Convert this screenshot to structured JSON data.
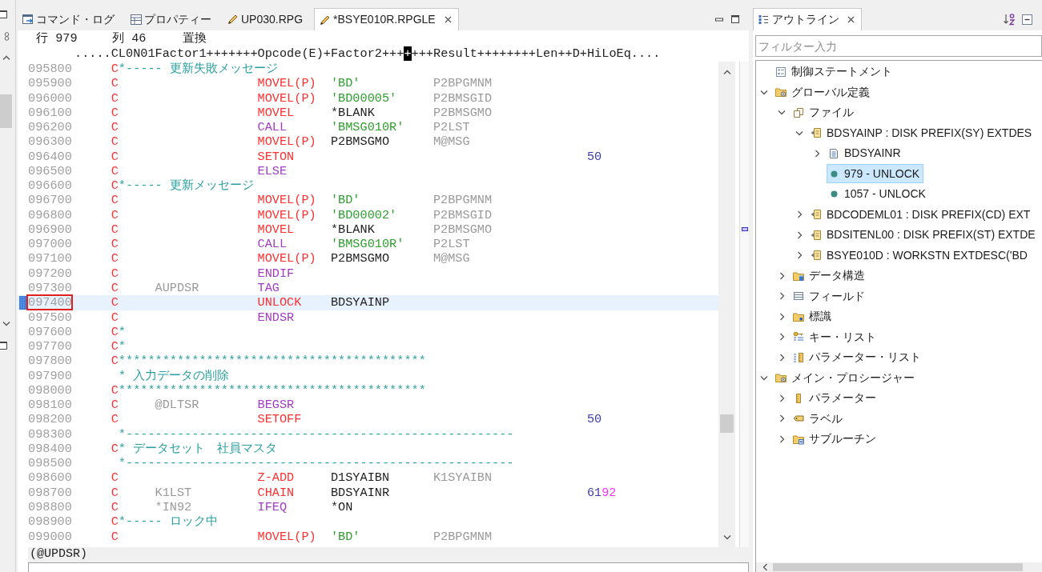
{
  "editor": {
    "tabs": [
      {
        "label": "コマンド・ログ",
        "kind": "log",
        "selected": false
      },
      {
        "label": "プロパティー",
        "kind": "properties",
        "selected": false
      },
      {
        "label": "UP030.RPG",
        "kind": "source",
        "selected": false
      },
      {
        "label": "*BSYE010R.RPGLE",
        "kind": "source",
        "selected": true
      }
    ],
    "status": {
      "line": "行 979",
      "column": "列 46",
      "mode": "置換"
    },
    "ruler": {
      "before": ".....CL0N01Factor1+++++++Opcode(E)+Factor2+++",
      "cursor": "+",
      "after": "+++Result++++++++Len++D+HiLoEq...."
    },
    "lines": [
      {
        "seq": "095800",
        "kind": "comment",
        "spec": "C",
        "comment": "*----- 更新失敗メッセージ",
        "current": false
      },
      {
        "seq": "095900",
        "kind": "code",
        "spec": "C",
        "opcode": {
          "text": "MOVEL(P)",
          "kind": "operation"
        },
        "factor2": {
          "text": "'BD'",
          "kind": "literal"
        },
        "result": "P2BPGMNM",
        "current": false
      },
      {
        "seq": "096000",
        "kind": "code",
        "spec": "C",
        "opcode": {
          "text": "MOVEL(P)",
          "kind": "operation"
        },
        "factor2": {
          "text": "'BD00005'",
          "kind": "literal"
        },
        "result": "P2BMSGID",
        "current": false
      },
      {
        "seq": "096100",
        "kind": "code",
        "spec": "C",
        "opcode": {
          "text": "MOVEL",
          "kind": "operation"
        },
        "factor2": {
          "text": "*BLANK",
          "kind": "name"
        },
        "result": "P2BMSGMO",
        "current": false
      },
      {
        "seq": "096200",
        "kind": "code",
        "spec": "C",
        "opcode": {
          "text": "CALL",
          "kind": "control"
        },
        "factor2": {
          "text": "'BMSG010R'",
          "kind": "literal"
        },
        "result": "P2LST",
        "current": false
      },
      {
        "seq": "096300",
        "kind": "code",
        "spec": "C",
        "opcode": {
          "text": "MOVEL(P)",
          "kind": "operation"
        },
        "factor2": {
          "text": "P2BMSGMO",
          "kind": "name"
        },
        "result": "M@MSG",
        "current": false
      },
      {
        "seq": "096400",
        "kind": "code",
        "spec": "C",
        "opcode": {
          "text": "SETON",
          "kind": "operation"
        },
        "indicators": [
          {
            "text": "50",
            "color": "#3c3ca8"
          }
        ],
        "current": false
      },
      {
        "seq": "096500",
        "kind": "code",
        "spec": "C",
        "opcode": {
          "text": "ELSE",
          "kind": "control"
        },
        "current": false
      },
      {
        "seq": "096600",
        "kind": "comment",
        "spec": "C",
        "comment": "*----- 更新メッセージ",
        "current": false
      },
      {
        "seq": "096700",
        "kind": "code",
        "spec": "C",
        "opcode": {
          "text": "MOVEL(P)",
          "kind": "operation"
        },
        "factor2": {
          "text": "'BD'",
          "kind": "literal"
        },
        "result": "P2BPGMNM",
        "current": false
      },
      {
        "seq": "096800",
        "kind": "code",
        "spec": "C",
        "opcode": {
          "text": "MOVEL(P)",
          "kind": "operation"
        },
        "factor2": {
          "text": "'BD00002'",
          "kind": "literal"
        },
        "result": "P2BMSGID",
        "current": false
      },
      {
        "seq": "096900",
        "kind": "code",
        "spec": "C",
        "opcode": {
          "text": "MOVEL",
          "kind": "operation"
        },
        "factor2": {
          "text": "*BLANK",
          "kind": "name"
        },
        "result": "P2BMSGMO",
        "current": false
      },
      {
        "seq": "097000",
        "kind": "code",
        "spec": "C",
        "opcode": {
          "text": "CALL",
          "kind": "control"
        },
        "factor2": {
          "text": "'BMSG010R'",
          "kind": "literal"
        },
        "result": "P2LST",
        "current": false
      },
      {
        "seq": "097100",
        "kind": "code",
        "spec": "C",
        "opcode": {
          "text": "MOVEL(P)",
          "kind": "operation"
        },
        "factor2": {
          "text": "P2BMSGMO",
          "kind": "name"
        },
        "result": "M@MSG",
        "current": false
      },
      {
        "seq": "097200",
        "kind": "code",
        "spec": "C",
        "opcode": {
          "text": "ENDIF",
          "kind": "control"
        },
        "current": false
      },
      {
        "seq": "097300",
        "kind": "code",
        "spec": "C",
        "factor1": "AUPDSR",
        "opcode": {
          "text": "TAG",
          "kind": "control"
        },
        "current": false
      },
      {
        "seq": "097400",
        "kind": "code",
        "spec": "C",
        "opcode": {
          "text": "UNLOCK",
          "kind": "operation"
        },
        "factor2": {
          "text": "BDSYAINP",
          "kind": "name"
        },
        "current": true,
        "boxed": true,
        "marker": true
      },
      {
        "seq": "097500",
        "kind": "code",
        "spec": "C",
        "opcode": {
          "text": "ENDSR",
          "kind": "control"
        },
        "current": false
      },
      {
        "seq": "097600",
        "kind": "comment",
        "spec": "C",
        "comment": "*",
        "current": false
      },
      {
        "seq": "097700",
        "kind": "comment",
        "spec": "C",
        "comment": "*",
        "current": false
      },
      {
        "seq": "097800",
        "kind": "comment",
        "spec": "C",
        "comment": "******************************************",
        "current": false
      },
      {
        "seq": "097900",
        "kind": "comment",
        "comment": "* 入力データの削除",
        "current": false
      },
      {
        "seq": "098000",
        "kind": "comment",
        "spec": "C",
        "comment": "******************************************",
        "current": false
      },
      {
        "seq": "098100",
        "kind": "code",
        "spec": "C",
        "factor1": "@DLTSR",
        "opcode": {
          "text": "BEGSR",
          "kind": "control"
        },
        "current": false
      },
      {
        "seq": "098200",
        "kind": "code",
        "spec": "C",
        "opcode": {
          "text": "SETOFF",
          "kind": "operation"
        },
        "indicators": [
          {
            "text": "50",
            "color": "#3c3ca8"
          }
        ],
        "current": false
      },
      {
        "seq": "098300",
        "kind": "comment",
        "comment": "*-----------------------------------------------------",
        "current": false
      },
      {
        "seq": "098400",
        "kind": "comment",
        "spec": "C",
        "comment": "* データセット　社員マスタ",
        "current": false
      },
      {
        "seq": "098500",
        "kind": "comment",
        "comment": "*-----------------------------------------------------",
        "current": false
      },
      {
        "seq": "098600",
        "kind": "code",
        "spec": "C",
        "opcode": {
          "text": "Z-ADD",
          "kind": "operation"
        },
        "factor2": {
          "text": "D1SYAIBN",
          "kind": "name"
        },
        "result": "K1SYAIBN",
        "current": false
      },
      {
        "seq": "098700",
        "kind": "code",
        "spec": "C",
        "factor1": "K1LST",
        "opcode": {
          "text": "CHAIN",
          "kind": "operation"
        },
        "factor2": {
          "text": "BDSYAINR",
          "kind": "name"
        },
        "indicators": [
          {
            "text": "61",
            "color": "#3c3ca8"
          },
          {
            "text": "92",
            "color": "#ff33ff"
          }
        ],
        "current": false
      },
      {
        "seq": "098800",
        "kind": "code",
        "spec": "C",
        "factor1": "*IN92",
        "opcode": {
          "text": "IFEQ",
          "kind": "control"
        },
        "factor2": {
          "text": "*ON",
          "kind": "name"
        },
        "current": false
      },
      {
        "seq": "098900",
        "kind": "comment",
        "spec": "C",
        "comment": "*----- ロック中",
        "current": false
      },
      {
        "seq": "099000",
        "kind": "code",
        "spec": "C",
        "opcode": {
          "text": "MOVEL(P)",
          "kind": "operation"
        },
        "factor2": {
          "text": "'BD'",
          "kind": "literal"
        },
        "result": "P2BPGMNM",
        "current": false
      }
    ],
    "scope": "(@UPDSR)"
  },
  "outline": {
    "tab": {
      "label": "アウトライン",
      "selected": true
    },
    "filter": {
      "placeholder": "フィルター入力"
    },
    "tree": [
      {
        "label": "制御ステートメント",
        "kind": "control-statements",
        "selected": false
      },
      {
        "label": "グローバル定義",
        "kind": "global",
        "expanded": true,
        "selected": false,
        "children": [
          {
            "label": "ファイル",
            "kind": "files",
            "expanded": true,
            "selected": false,
            "children": [
              {
                "label": "BDSYAINP : DISK PREFIX(SY) EXTDES",
                "kind": "file",
                "expanded": true,
                "selected": false,
                "children": [
                  {
                    "label": "BDSYAINR",
                    "kind": "record",
                    "expanded": false,
                    "selected": false
                  },
                  {
                    "label": "979 - UNLOCK",
                    "kind": "statement",
                    "selected": true
                  },
                  {
                    "label": "1057 - UNLOCK",
                    "kind": "statement",
                    "selected": false
                  }
                ]
              },
              {
                "label": "BDCODEML01 : DISK PREFIX(CD) EXT",
                "kind": "file",
                "expanded": false,
                "selected": false
              },
              {
                "label": "BDSITENL00 : DISK PREFIX(ST) EXTDE",
                "kind": "file",
                "expanded": false,
                "selected": false
              },
              {
                "label": "BSYE010D : WORKSTN EXTDESC('BD",
                "kind": "file",
                "expanded": false,
                "selected": false
              }
            ]
          },
          {
            "label": "データ構造",
            "kind": "data-structures",
            "expanded": false,
            "selected": false
          },
          {
            "label": "フィールド",
            "kind": "fields",
            "expanded": false,
            "selected": false
          },
          {
            "label": "標識",
            "kind": "indicators",
            "expanded": false,
            "selected": false
          },
          {
            "label": "キー・リスト",
            "kind": "key-lists",
            "expanded": false,
            "selected": false
          },
          {
            "label": "パラメーター・リスト",
            "kind": "parameter-lists",
            "expanded": false,
            "selected": false
          }
        ]
      },
      {
        "label": "メイン・プロシージャー",
        "kind": "procedure",
        "expanded": true,
        "selected": false,
        "children": [
          {
            "label": "パラメーター",
            "kind": "parameters",
            "expanded": false,
            "selected": false
          },
          {
            "label": "ラベル",
            "kind": "labels",
            "expanded": false,
            "selected": false
          },
          {
            "label": "サブルーチン",
            "kind": "subroutines",
            "expanded": false,
            "selected": false
          }
        ]
      }
    ]
  }
}
